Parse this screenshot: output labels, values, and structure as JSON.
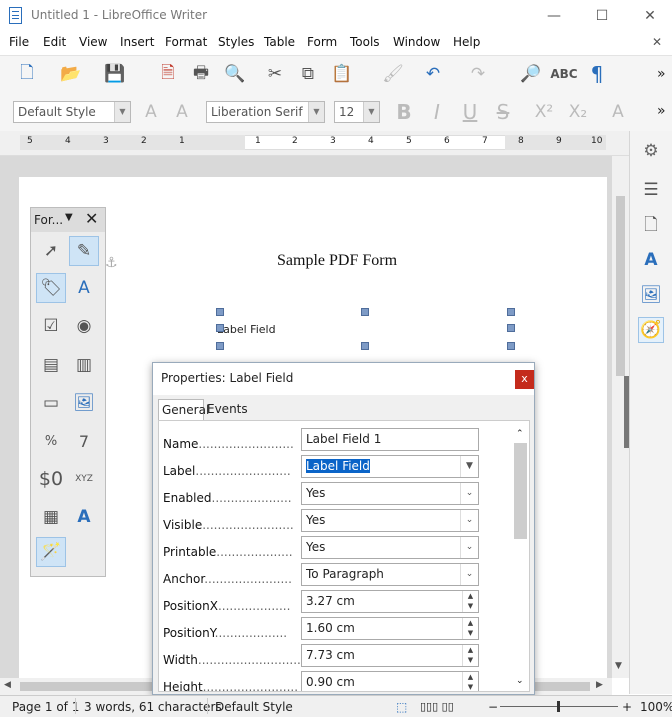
{
  "window": {
    "title": "Untitled 1 - LibreOffice Writer",
    "min": "—",
    "max": "☐",
    "close": "✕"
  },
  "menu": [
    "File",
    "Edit",
    "View",
    "Insert",
    "Format",
    "Styles",
    "Table",
    "Form",
    "Tools",
    "Window",
    "Help"
  ],
  "menu_close": "✕",
  "toolbar": {
    "more": "»"
  },
  "format_bar": {
    "para_style": "Default Style",
    "font_name": "Liberation Serif",
    "font_size": "12"
  },
  "ruler": {
    "ticks": [
      "5",
      "4",
      "3",
      "2",
      "1",
      "1",
      "2",
      "3",
      "4",
      "5",
      "6",
      "7",
      "8",
      "9",
      "10"
    ]
  },
  "document": {
    "heading": "Sample PDF Form",
    "label_field": "Label Field"
  },
  "form_toolbar": {
    "title": "For..."
  },
  "dialog": {
    "title": "Properties: Label Field",
    "close": "x",
    "tabs": [
      "General",
      "Events"
    ],
    "rows": [
      {
        "label": "Name",
        "value": "Label Field 1",
        "kind": "text"
      },
      {
        "label": "Label",
        "value": "Label Field",
        "kind": "combo"
      },
      {
        "label": "Enabled",
        "value": "Yes",
        "kind": "select"
      },
      {
        "label": "Visible",
        "value": "Yes",
        "kind": "select"
      },
      {
        "label": "Printable",
        "value": "Yes",
        "kind": "select"
      },
      {
        "label": "Anchor",
        "value": "To Paragraph",
        "kind": "select"
      },
      {
        "label": "PositionX",
        "value": "3.27 cm",
        "kind": "spin"
      },
      {
        "label": "PositionY",
        "value": "1.60 cm",
        "kind": "spin"
      },
      {
        "label": "Width",
        "value": "7.73 cm",
        "kind": "spin"
      },
      {
        "label": "Height",
        "value": "0.90 cm",
        "kind": "spin"
      }
    ]
  },
  "status": {
    "page": "Page 1 of 1",
    "words": "3 words, 61 characters",
    "style": "Default Style",
    "zoom": "100%"
  },
  "colors": {
    "accent": "#2a6ebb",
    "highlight": "#0a64c8",
    "close_red": "#c42b1c"
  }
}
